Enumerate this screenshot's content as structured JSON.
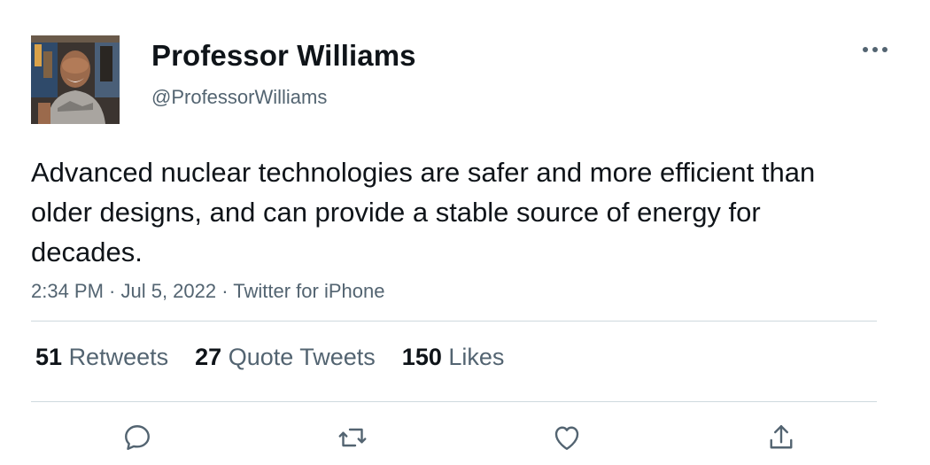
{
  "tweet": {
    "author_name": "Professor Williams",
    "author_handle": "@ProfessorWilliams",
    "text": "Advanced nuclear technologies are safer and more efficient than older designs, and can provide a stable source of energy for decades.",
    "timestamp": "2:34 PM · Jul 5, 2022 · Twitter for iPhone"
  },
  "stats": [
    {
      "count": "51",
      "label": "Retweets"
    },
    {
      "count": "27",
      "label": "Quote Tweets"
    },
    {
      "count": "150",
      "label": "Likes"
    }
  ],
  "icons": {
    "more": "more-options-icon",
    "reply": "reply-icon",
    "retweet": "retweet-icon",
    "like": "heart-icon",
    "share": "share-icon"
  },
  "colors": {
    "text": "#0f1419",
    "secondary": "#536471",
    "divider": "#cfd9de"
  }
}
